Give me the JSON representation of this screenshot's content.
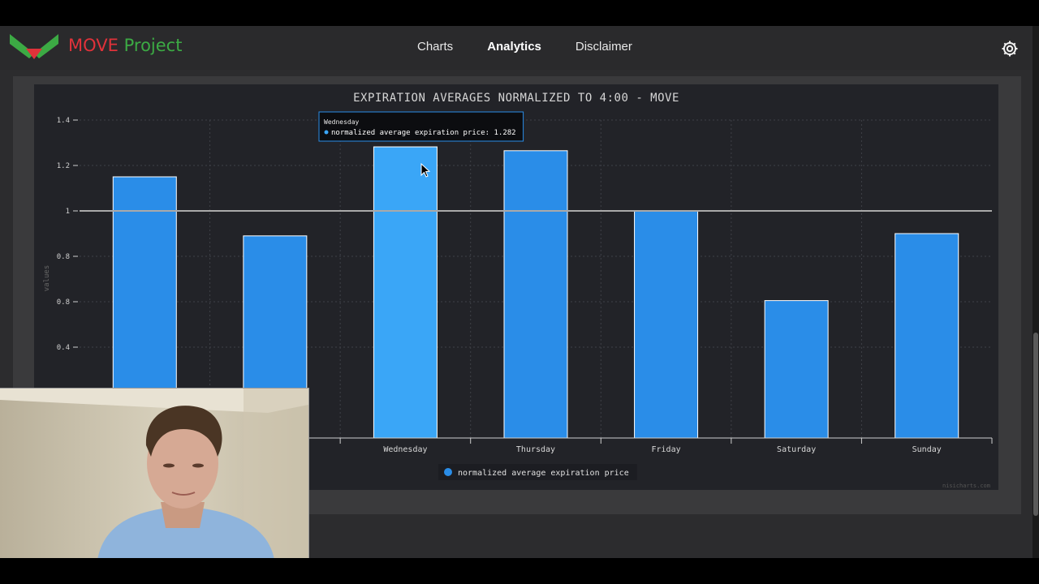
{
  "navbar": {
    "brand_part1": "MOVE",
    "brand_part2": "Project",
    "links": [
      {
        "label": "Charts",
        "active": false
      },
      {
        "label": "Analytics",
        "active": true
      },
      {
        "label": "Disclaimer",
        "active": false
      }
    ],
    "settings_icon": "gear-icon"
  },
  "colors": {
    "brand_red": "#e0323a",
    "brand_green": "#3caa44",
    "bar": "#2a8de8",
    "bar_hover": "#3aa6f7",
    "background": "#222328"
  },
  "chart_data": {
    "type": "bar",
    "title": "EXPIRATION AVERAGES NORMALIZED TO 4:00 - MOVE",
    "ylabel": "values",
    "ylim": [
      0,
      1.4
    ],
    "yticks": [
      "1.4",
      "1.2",
      "1",
      "0.8",
      "0.8",
      "0.4"
    ],
    "categories": [
      "",
      "",
      "Wednesday",
      "Thursday",
      "Friday",
      "Saturday",
      "Sunday"
    ],
    "series": [
      {
        "name": "normalized average expiration price",
        "values": [
          1.15,
          0.89,
          1.282,
          1.265,
          1.0,
          0.605,
          0.9
        ]
      }
    ],
    "reference_line": 1,
    "grid": true,
    "legend": "bottom-center",
    "tooltip": {
      "category": "Wednesday",
      "text": "normalized average expiration price: 1.282"
    },
    "credit": "nisicharts.com"
  }
}
